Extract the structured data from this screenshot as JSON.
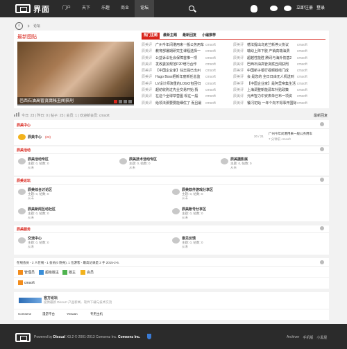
{
  "header": {
    "logo_text": "界面",
    "nav": [
      "门户",
      "天下",
      "乐趣",
      "商业",
      "论坛"
    ],
    "register": "立即注册",
    "login": "登录"
  },
  "breadcrumb": {
    "home": "⌂",
    "current": "论坛"
  },
  "hot": {
    "title": "最新图贴",
    "caption": "芭西石油高管贪腐帐丑闻获刑"
  },
  "tabs": [
    "热门主题",
    "最新主题",
    "最新回复",
    "小编推荐"
  ],
  "threads": [
    [
      {
        "forum": "辰美评",
        "title": "广州今年闭港用来一般公务用车",
        "author": "cmsoft"
      },
      {
        "forum": "辰美评",
        "title": "德法提出乌克兰新停火协议",
        "author": "cmsoft"
      }
    ],
    [
      {
        "forum": "辰美评",
        "title": "教育部暑期研究生课程选择一",
        "author": "cmsoft"
      },
      {
        "forum": "辰美评",
        "title": "瑞幼上阵下肢 产销高端油费",
        "author": "cmsoft"
      }
    ],
    [
      {
        "forum": "辰美评",
        "title": "公益诉讼社会保障首推一项",
        "author": "cmsoft"
      },
      {
        "forum": "辰美评",
        "title": "超越性能胜 腾讯与海外债基2",
        "author": "cmsoft"
      }
    ],
    [
      {
        "forum": "辰美评",
        "title": "发改委加规范P2P增行合作",
        "author": "cmsoft"
      },
      {
        "forum": "辰美评",
        "title": "巴西石油高管贪腐丑闻获刑",
        "author": "cmsoft"
      }
    ],
    [
      {
        "forum": "辰美评",
        "title": "【中国企业家】任志强已出州",
        "author": "cmsoft"
      },
      {
        "forum": "辰美评",
        "title": "中国新子银行视频截线门成",
        "author": "cmsoft"
      }
    ],
    [
      {
        "forum": "辰美评",
        "title": "Hugo Boss把新年度新任总监",
        "author": "cmsoft"
      },
      {
        "forum": "辰美评",
        "title": "会 是您的 全日日由无人机送到",
        "author": "cmsoft"
      }
    ],
    [
      {
        "forum": "辰美评",
        "title": "LV设计师演重的LOGO包回归",
        "author": "cmsoft"
      },
      {
        "forum": "辰美评",
        "title": "【中国企业家】是阿里帝集生活",
        "author": "cmsoft"
      }
    ],
    [
      {
        "forum": "辰美评",
        "title": "超纺收购过先业交易开始 猜",
        "author": "cmsoft"
      },
      {
        "forum": "辰美评",
        "title": "上海调整新能源车补贴政策",
        "author": "cmsoft"
      }
    ],
    [
      {
        "forum": "辰美评",
        "title": "在这个全球草营图 现在一般",
        "author": "cmsoft"
      },
      {
        "forum": "辰美评",
        "title": "元声智力中安表单已布一项资",
        "author": "cmsoft"
      }
    ],
    [
      {
        "forum": "辰美评",
        "title": "给领法那要要能细优了 而且最",
        "author": "cmsoft"
      },
      {
        "forum": "辰美评",
        "title": "餐闪初始 一年个向不得事开国际",
        "author": "cmsoft"
      }
    ]
  ],
  "stats": {
    "text": "今日: 23 | 昨日: 0 | 帖子: 23 | 会员: 1 | 欢迎新会员: cmsoft",
    "new_posts": "最新回复"
  },
  "sections": [
    {
      "title": "辰美中心"
    },
    {
      "title": "辰美活动"
    },
    {
      "title": "辰美论坛"
    },
    {
      "title": "辰美服务"
    }
  ],
  "center_forum": {
    "name": "辰美中心",
    "today": "(23)",
    "counts": "20 / 21",
    "last_title": "广州今年闭港用来一般公务用车",
    "last_time": "7 分钟前 cmsoft"
  },
  "activity_forums": [
    {
      "name": "辰美活动专区",
      "meta": "主题: 0, 帖数: 0",
      "sub": "从未"
    },
    {
      "name": "辰美技术活动专区",
      "meta": "主题: 0, 帖数: 0",
      "sub": "从未"
    },
    {
      "name": "辰美摄影展",
      "meta": "主题: 0, 帖数: 0",
      "sub": "从未"
    }
  ],
  "bbs_forums": [
    {
      "name": "辰美综合讨论区",
      "meta": "主题: 0, 帖数: 0",
      "sub": "从未"
    },
    {
      "name": "辰美软件游戏分享区",
      "meta": "主题: 0, 帖数: 0",
      "sub": "从未"
    },
    {
      "name": "辰美新闻互动社区",
      "meta": "主题: 0, 帖数: 0",
      "sub": "从未"
    },
    {
      "name": "辰美账号分享区",
      "meta": "主题: 0, 帖数: 0",
      "sub": "从未"
    }
  ],
  "service_forums": [
    {
      "name": "交流中心",
      "meta": "主题: 0, 帖数: 0",
      "sub": "从未"
    },
    {
      "name": "意见反馈",
      "meta": "主题: 0, 帖数: 0",
      "sub": "从未"
    }
  ],
  "online": {
    "title": "在线会员 - 2 人在线 - 1 会员(0 隐身), 1 位游客 - 最高记录是 2 于 2015-2-6.",
    "legend": [
      {
        "label": "管理员",
        "color": "#f28c1c"
      },
      {
        "label": "超级版主",
        "color": "#3a8ed8"
      },
      {
        "label": "版主",
        "color": "#4fb34f"
      },
      {
        "label": "会员",
        "color": "#f2b21c"
      }
    ],
    "user": "cmsoft"
  },
  "friend": {
    "title": "官方论坛",
    "desc": "提供最新 Discuz! 产品新闻、软件下载与技术交流",
    "links": [
      "Comsenz",
      "漫游平台",
      "Yeswan",
      "专用主机"
    ]
  },
  "footer": {
    "powered": "Powered by",
    "product": "Discuz!",
    "version": "X3.2 © 2001-2013 Comsenz Inc.",
    "company": "Comsenz Inc.",
    "archiver": "Archiver",
    "mobile": "手机版",
    "dark": "小黑屋"
  }
}
